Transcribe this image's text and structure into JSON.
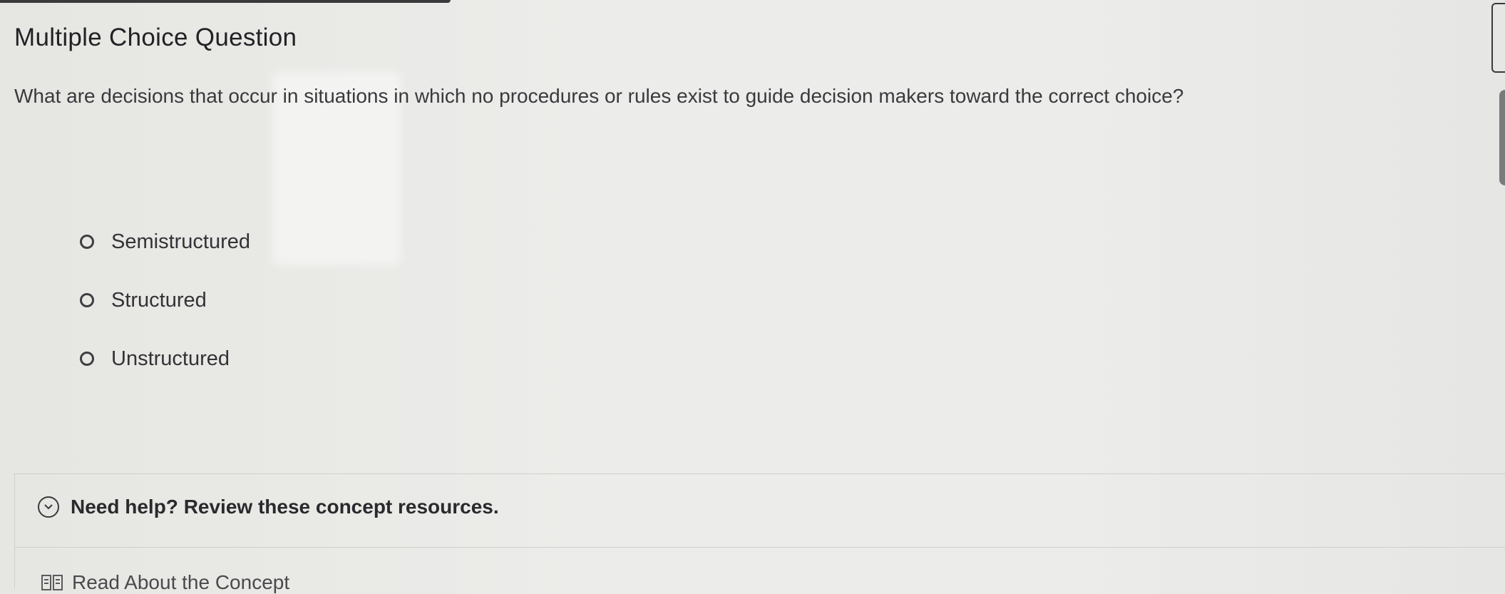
{
  "question": {
    "heading": "Multiple Choice Question",
    "prompt": "What are decisions that occur in situations in which no procedures or rules exist to guide decision makers toward the correct choice?",
    "options": [
      {
        "label": "Semistructured",
        "selected": false
      },
      {
        "label": "Structured",
        "selected": false
      },
      {
        "label": "Unstructured",
        "selected": false
      }
    ]
  },
  "help": {
    "toggle_label": "Need help? Review these concept resources.",
    "icon": "chevron-down-icon",
    "resources": [
      {
        "label": "Read About the Concept",
        "icon": "book-icon"
      }
    ]
  }
}
